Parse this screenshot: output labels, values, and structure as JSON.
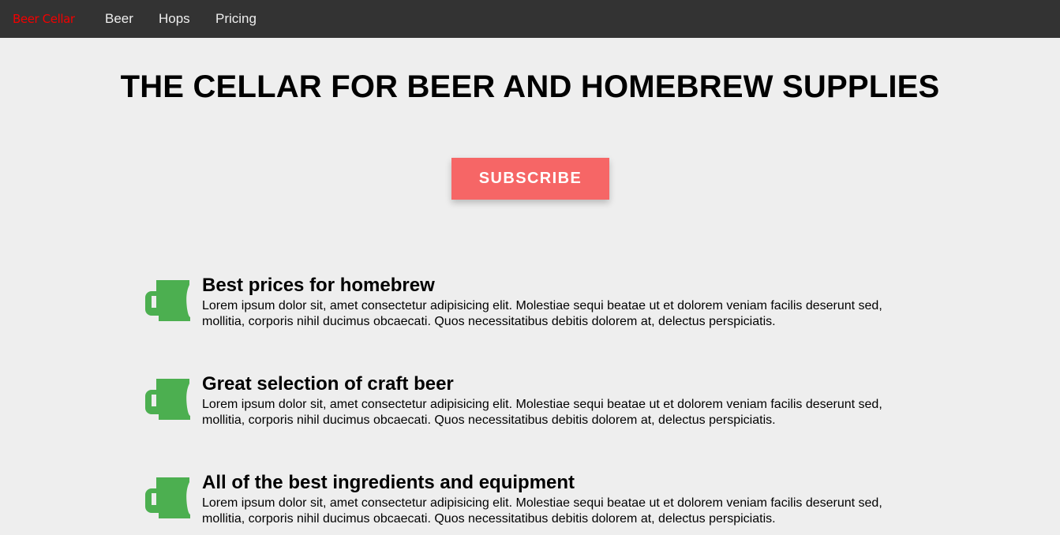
{
  "nav": {
    "brand": "Beer Cellar",
    "items": [
      "Beer",
      "Hops",
      "Pricing"
    ]
  },
  "hero": {
    "title": "THE CELLAR FOR BEER AND HOMEBREW SUPPLIES",
    "subscribe_label": "SUBSCRIBE"
  },
  "features": [
    {
      "icon": "beer-mug-icon",
      "title": "Best prices for homebrew",
      "text": "Lorem ipsum dolor sit, amet consectetur adipisicing elit. Molestiae sequi beatae ut et dolorem veniam facilis deserunt sed, mollitia, corporis nihil ducimus obcaecati. Quos necessitatibus debitis dolorem at, delectus perspiciatis."
    },
    {
      "icon": "beer-mug-icon",
      "title": "Great selection of craft beer",
      "text": "Lorem ipsum dolor sit, amet consectetur adipisicing elit. Molestiae sequi beatae ut et dolorem veniam facilis deserunt sed, mollitia, corporis nihil ducimus obcaecati. Quos necessitatibus debitis dolorem at, delectus perspiciatis."
    },
    {
      "icon": "beer-mug-icon",
      "title": "All of the best ingredients and equipment",
      "text": "Lorem ipsum dolor sit, amet consectetur adipisicing elit. Molestiae sequi beatae ut et dolorem veniam facilis deserunt sed, mollitia, corporis nihil ducimus obcaecati. Quos necessitatibus debitis dolorem at, delectus perspiciatis."
    }
  ],
  "colors": {
    "nav_bg": "#333333",
    "brand": "#f20000",
    "page_bg": "#eeeeee",
    "button": "#f66666",
    "icon": "#4caf50"
  }
}
